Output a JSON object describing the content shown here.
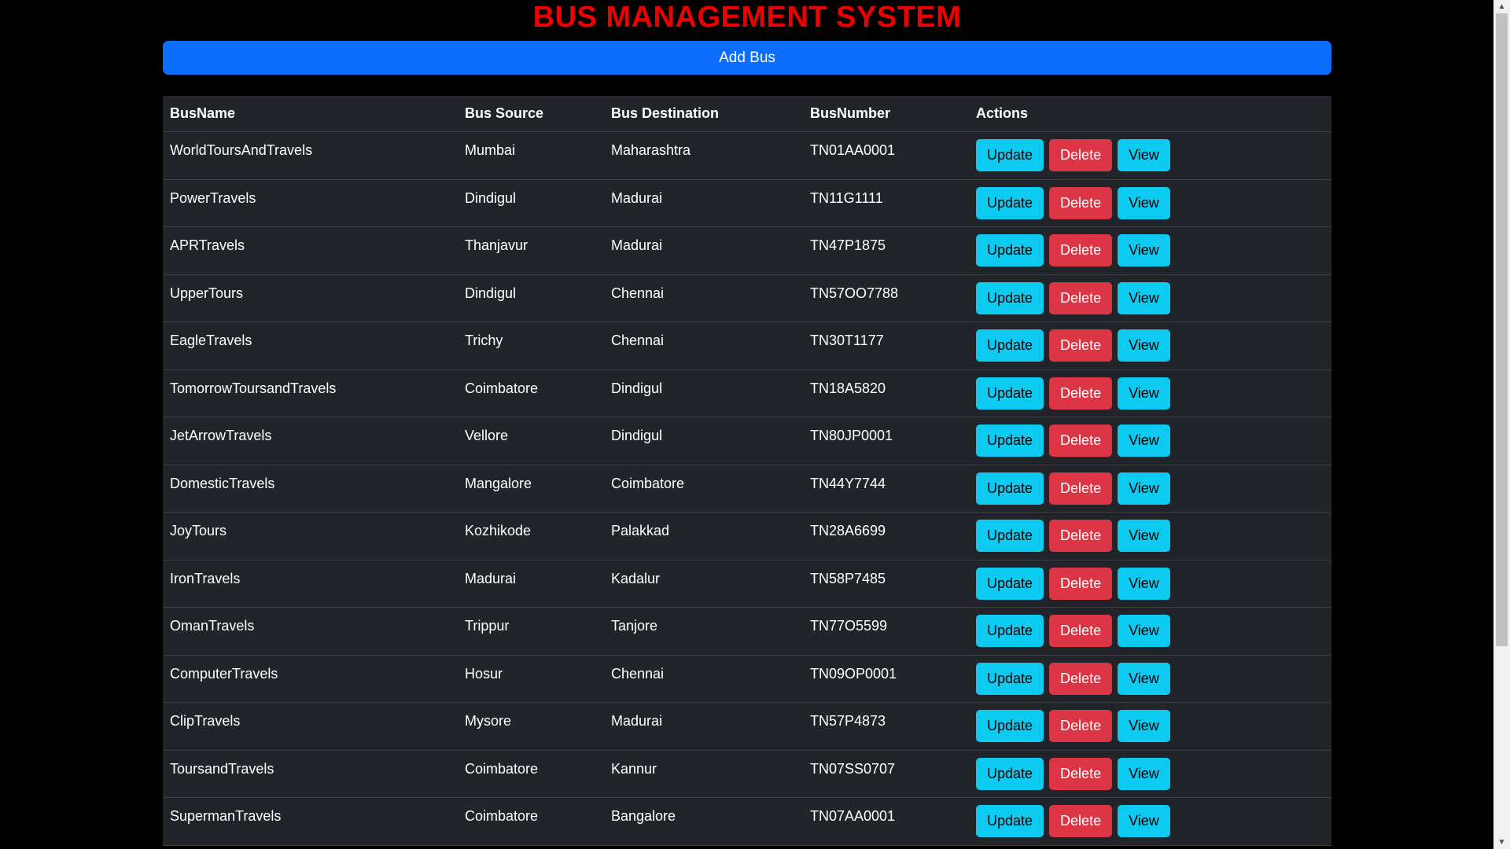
{
  "page": {
    "title": "BUS MANAGEMENT SYSTEM",
    "add_button_label": "Add Bus"
  },
  "table": {
    "headers": {
      "name": "BusName",
      "source": "Bus Source",
      "destination": "Bus Destination",
      "number": "BusNumber",
      "actions": "Actions"
    },
    "action_labels": {
      "update": "Update",
      "delete": "Delete",
      "view": "View"
    },
    "rows": [
      {
        "name": "WorldToursAndTravels",
        "source": "Mumbai",
        "destination": "Maharashtra",
        "number": "TN01AA0001"
      },
      {
        "name": "PowerTravels",
        "source": "Dindigul",
        "destination": "Madurai",
        "number": "TN11G1111"
      },
      {
        "name": "APRTravels",
        "source": "Thanjavur",
        "destination": "Madurai",
        "number": "TN47P1875"
      },
      {
        "name": "UpperTours",
        "source": "Dindigul",
        "destination": "Chennai",
        "number": "TN57OO7788"
      },
      {
        "name": "EagleTravels",
        "source": "Trichy",
        "destination": "Chennai",
        "number": "TN30T1177"
      },
      {
        "name": "TomorrowToursandTravels",
        "source": "Coimbatore",
        "destination": "Dindigul",
        "number": "TN18A5820"
      },
      {
        "name": "JetArrowTravels",
        "source": "Vellore",
        "destination": "Dindigul",
        "number": "TN80JP0001"
      },
      {
        "name": "DomesticTravels",
        "source": "Mangalore",
        "destination": "Coimbatore",
        "number": "TN44Y7744"
      },
      {
        "name": "JoyTours",
        "source": "Kozhikode",
        "destination": "Palakkad",
        "number": "TN28A6699"
      },
      {
        "name": "IronTravels",
        "source": "Madurai",
        "destination": "Kadalur",
        "number": "TN58P7485"
      },
      {
        "name": "OmanTravels",
        "source": "Trippur",
        "destination": "Tanjore",
        "number": "TN77O5599"
      },
      {
        "name": "ComputerTravels",
        "source": "Hosur",
        "destination": "Chennai",
        "number": "TN09OP0001"
      },
      {
        "name": "ClipTravels",
        "source": "Mysore",
        "destination": "Madurai",
        "number": "TN57P4873"
      },
      {
        "name": "ToursandTravels",
        "source": "Coimbatore",
        "destination": "Kannur",
        "number": "TN07SS0707"
      },
      {
        "name": "SupermanTravels",
        "source": "Coimbatore",
        "destination": "Bangalore",
        "number": "TN07AA0001"
      }
    ]
  },
  "scrollbar": {
    "up_icon": "triangle-up-icon",
    "down_icon": "triangle-down-icon"
  },
  "colors": {
    "title": "#ee0000",
    "primary": "#0d6efd",
    "info": "#0dcaf0",
    "danger": "#dc3545",
    "table_bg": "#212529",
    "page_bg": "#000000"
  }
}
